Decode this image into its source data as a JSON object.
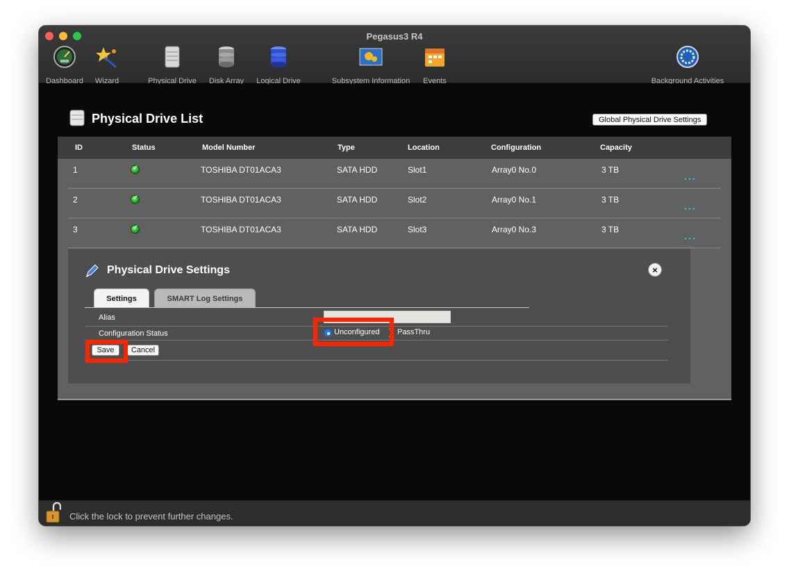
{
  "window": {
    "title": "Pegasus3 R4"
  },
  "toolbar": {
    "items": [
      {
        "label": "Dashboard",
        "icon": "dashboard-icon"
      },
      {
        "label": "Wizard",
        "icon": "wizard-icon"
      },
      {
        "label": "Physical Drive",
        "icon": "physical-drive-icon"
      },
      {
        "label": "Disk Array",
        "icon": "disk-array-icon"
      },
      {
        "label": "Logical Drive",
        "icon": "logical-drive-icon"
      },
      {
        "label": "Subsystem Information",
        "icon": "subsystem-information-icon"
      },
      {
        "label": "Events",
        "icon": "events-icon"
      },
      {
        "label": "Background Activities",
        "icon": "background-activities-icon"
      }
    ]
  },
  "list": {
    "title": "Physical Drive List",
    "global_button": "Global Physical Drive Settings",
    "columns": [
      "ID",
      "Status",
      "Model Number",
      "Type",
      "Location",
      "Configuration",
      "Capacity"
    ],
    "rows": [
      {
        "id": "1",
        "status": "ok",
        "model": "TOSHIBA DT01ACA3",
        "type": "SATA HDD",
        "location": "Slot1",
        "configuration": "Array0 No.0",
        "capacity": "3 TB",
        "more": "..."
      },
      {
        "id": "2",
        "status": "ok",
        "model": "TOSHIBA DT01ACA3",
        "type": "SATA HDD",
        "location": "Slot2",
        "configuration": "Array0 No.1",
        "capacity": "3 TB",
        "more": "..."
      },
      {
        "id": "3",
        "status": "ok",
        "model": "TOSHIBA DT01ACA3",
        "type": "SATA HDD",
        "location": "Slot3",
        "configuration": "Array0 No.3",
        "capacity": "3 TB",
        "more": "..."
      }
    ]
  },
  "settings": {
    "title": "Physical Drive Settings",
    "close_label": "×",
    "tabs": [
      {
        "label": "Settings",
        "active": true
      },
      {
        "label": "SMART Log Settings",
        "active": false
      }
    ],
    "alias": {
      "label": "Alias",
      "value": ""
    },
    "config_status": {
      "label": "Configuration Status",
      "options": [
        "Unconfigured",
        "PassThru"
      ],
      "selected": "Unconfigured"
    },
    "buttons": {
      "save": "Save",
      "cancel": "Cancel"
    }
  },
  "footer": {
    "text": "Click the lock to prevent further changes."
  },
  "colors": {
    "highlight": "#ff2300",
    "more_accent": "#2ed0f0",
    "status_ok": "#1aa31a"
  }
}
